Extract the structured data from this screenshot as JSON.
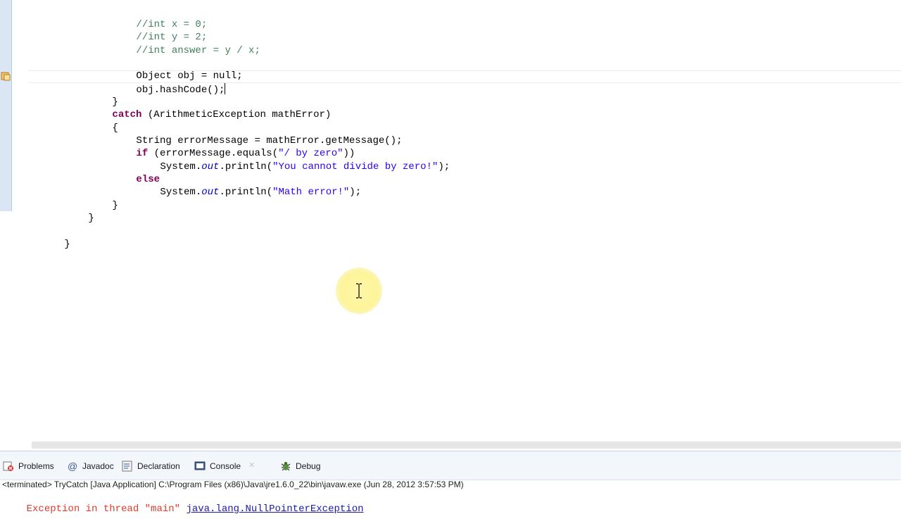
{
  "editor": {
    "code_lines": {
      "l1_comment": "//int x = 0;",
      "l2_comment": "//int y = 2;",
      "l3_comment": "//int answer = y / x;",
      "l5": "Object obj = null;",
      "l6": "obj.hashCode();",
      "l7": "}",
      "l8_catch": "catch",
      "l8_rest": " (ArithmeticException mathError)",
      "l9": "{",
      "l10": "String errorMessage = mathError.getMessage();",
      "l11_if": "if",
      "l11_rest": " (errorMessage.equals(",
      "l11_str": "\"/ by zero\"",
      "l11_end": "))",
      "l12_sys": "System.",
      "l12_out": "out",
      "l12_mid": ".println(",
      "l12_str": "\"You cannot divide by zero!\"",
      "l12_end": ");",
      "l13_else": "else",
      "l14_sys": "System.",
      "l14_out": "out",
      "l14_mid": ".println(",
      "l14_str": "\"Math error!\"",
      "l14_end": ");",
      "l15": "}",
      "l16": "}",
      "l17": "}"
    }
  },
  "panel": {
    "tabs": [
      {
        "label": "Problems",
        "icon": "problems-icon"
      },
      {
        "label": "Javadoc",
        "icon": "at-icon"
      },
      {
        "label": "Declaration",
        "icon": "declaration-icon"
      },
      {
        "label": "Console",
        "icon": "console-icon"
      },
      {
        "label": "Debug",
        "icon": "debug-icon"
      }
    ],
    "terminated": "<terminated> TryCatch [Java Application] C:\\Program Files (x86)\\Java\\jre1.6.0_22\\bin\\javaw.exe (Jun 28, 2012 3:57:53 PM)",
    "exception_prefix": "Exception in thread \"main\" ",
    "exception_link": "java.lang.NullPointerException"
  },
  "colors": {
    "keyword": "#7f0055",
    "comment": "#3f7f5f",
    "string": "#2a00ff",
    "error": "#e23a2a"
  }
}
